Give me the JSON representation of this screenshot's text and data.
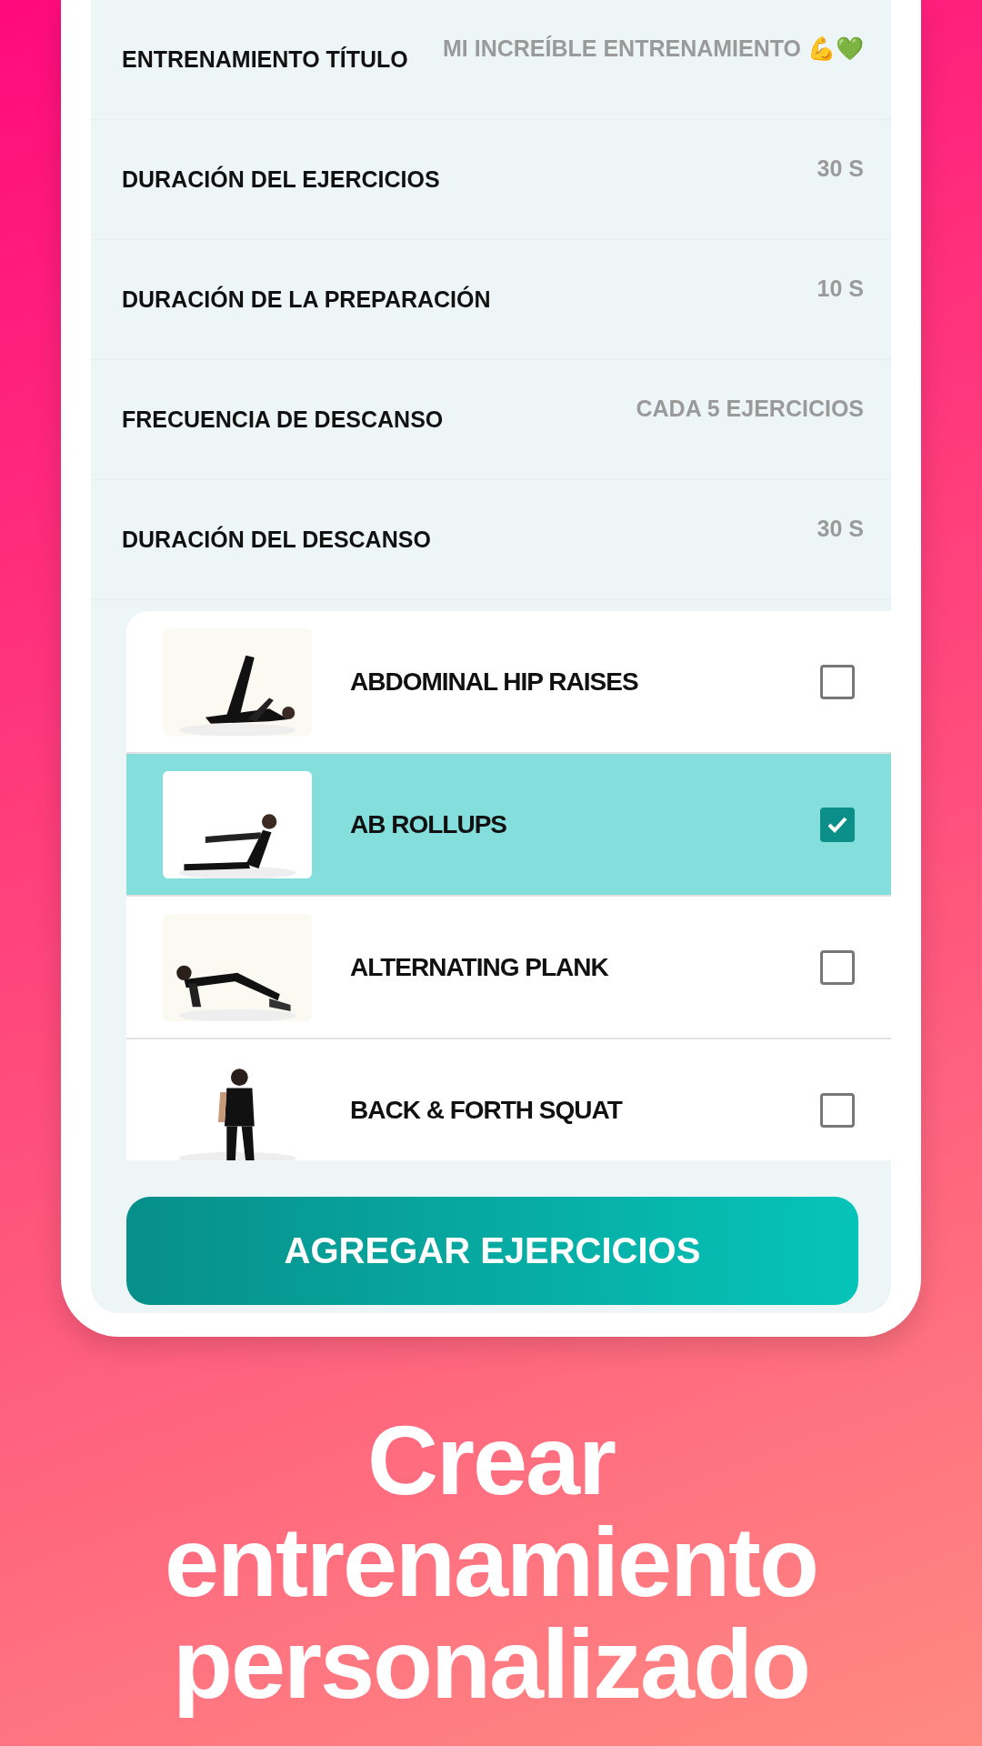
{
  "settings": [
    {
      "label": "ENTRENAMIENTO TÍTULO",
      "value": "MI INCREÍBLE ENTRENAMIENTO 💪💚"
    },
    {
      "label": "DURACIÓN DEL EJERCICIOS",
      "value": "30 S"
    },
    {
      "label": "DURACIÓN DE LA PREPARACIÓN",
      "value": "10 S"
    },
    {
      "label": "FRECUENCIA DE DESCANSO",
      "value": "CADA 5 EJERCICIOS"
    },
    {
      "label": "DURACIÓN DEL DESCANSO",
      "value": "30 S"
    }
  ],
  "exercises": [
    {
      "name": "ABDOMINAL HIP RAISES",
      "selected": false
    },
    {
      "name": "AB ROLLUPS",
      "selected": true
    },
    {
      "name": "ALTERNATING PLANK",
      "selected": false
    },
    {
      "name": "BACK & FORTH SQUAT",
      "selected": false
    }
  ],
  "button": "AGREGAR EJERCICIOS",
  "caption": "Crear entrenamiento personalizado"
}
